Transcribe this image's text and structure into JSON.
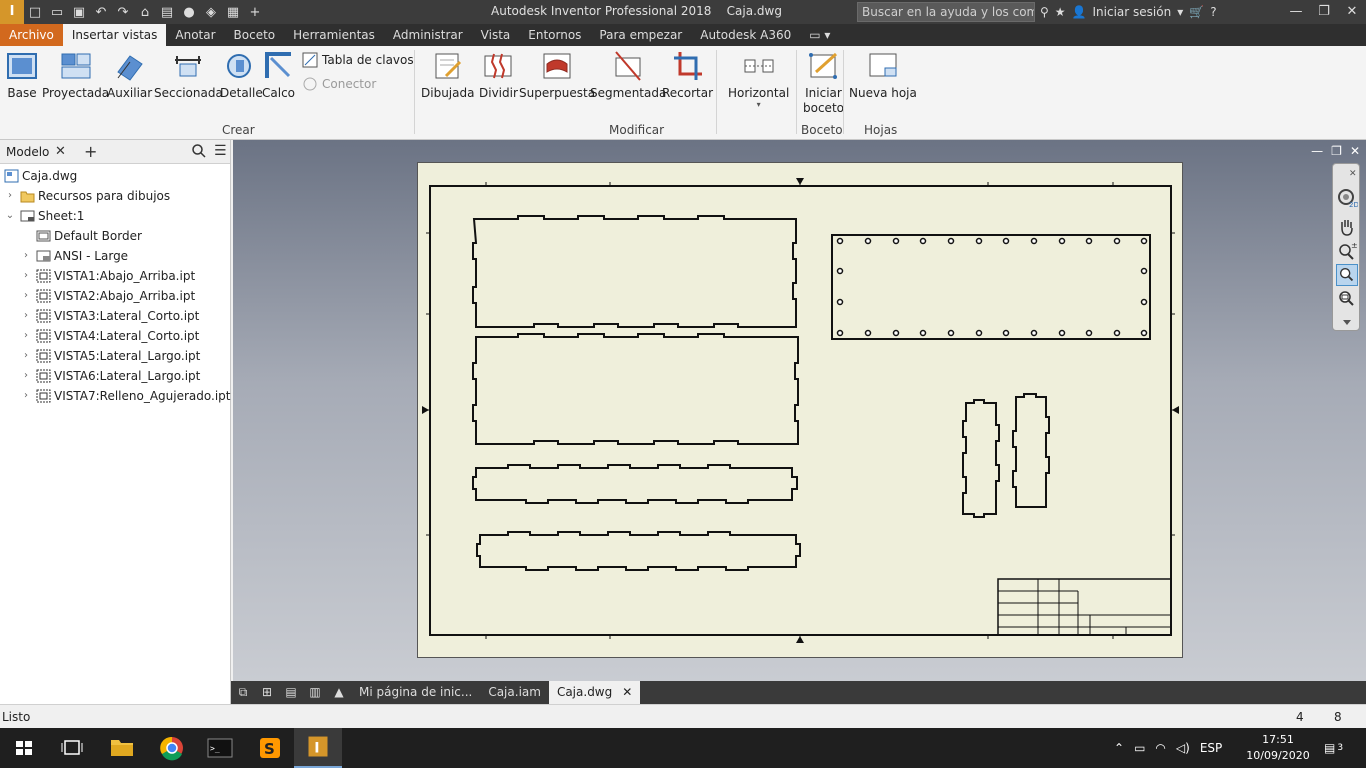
{
  "titlebar": {
    "app_title": "Autodesk Inventor Professional 2018",
    "doc_title": "Caja.dwg",
    "search_placeholder": "Buscar en la ayuda y los comand",
    "signin": "Iniciar sesión",
    "logo_text": "I"
  },
  "tabs": [
    {
      "label": "Archivo"
    },
    {
      "label": "Insertar vistas"
    },
    {
      "label": "Anotar"
    },
    {
      "label": "Boceto"
    },
    {
      "label": "Herramientas"
    },
    {
      "label": "Administrar"
    },
    {
      "label": "Vista"
    },
    {
      "label": "Entornos"
    },
    {
      "label": "Para empezar"
    },
    {
      "label": "Autodesk A360"
    }
  ],
  "ribbon": {
    "crear": {
      "label": "Crear",
      "base": "Base",
      "proyectada": "Proyectada",
      "auxiliar": "Auxiliar",
      "seccionada": "Seccionada",
      "detalle": "Detalle",
      "calco": "Calco",
      "tabla_clavos": "Tabla de clavos",
      "conector": "Conector"
    },
    "modificar": {
      "label": "Modificar",
      "dibujada": "Dibujada",
      "dividir": "Dividir",
      "superpuesta": "Superpuesta",
      "segmentada": "Segmentada",
      "recortar": "Recortar",
      "horizontal": "Horizontal"
    },
    "boceto": {
      "label": "Boceto",
      "iniciar_line1": "Iniciar",
      "iniciar_line2": "boceto"
    },
    "hojas": {
      "label": "Hojas",
      "nueva_hoja": "Nueva hoja"
    }
  },
  "browser": {
    "tab_label": "Modelo",
    "nodes": [
      {
        "label": "Caja.dwg"
      },
      {
        "label": "Recursos para dibujos"
      },
      {
        "label": "Sheet:1"
      },
      {
        "label": "Default Border"
      },
      {
        "label": "ANSI - Large"
      },
      {
        "label": "VISTA1:Abajo_Arriba.ipt"
      },
      {
        "label": "VISTA2:Abajo_Arriba.ipt"
      },
      {
        "label": "VISTA3:Lateral_Corto.ipt"
      },
      {
        "label": "VISTA4:Lateral_Corto.ipt"
      },
      {
        "label": "VISTA5:Lateral_Largo.ipt"
      },
      {
        "label": "VISTA6:Lateral_Largo.ipt"
      },
      {
        "label": "VISTA7:Relleno_Agujerado.ipt"
      }
    ]
  },
  "doctabs": {
    "tab1": "Mi página de inic...",
    "tab2": "Caja.iam",
    "tab3": "Caja.dwg"
  },
  "status": {
    "text": "Listo",
    "num1": "4",
    "num2": "8"
  },
  "tray": {
    "lang": "ESP",
    "time": "17:51",
    "date": "10/09/2020",
    "notif": "3"
  }
}
